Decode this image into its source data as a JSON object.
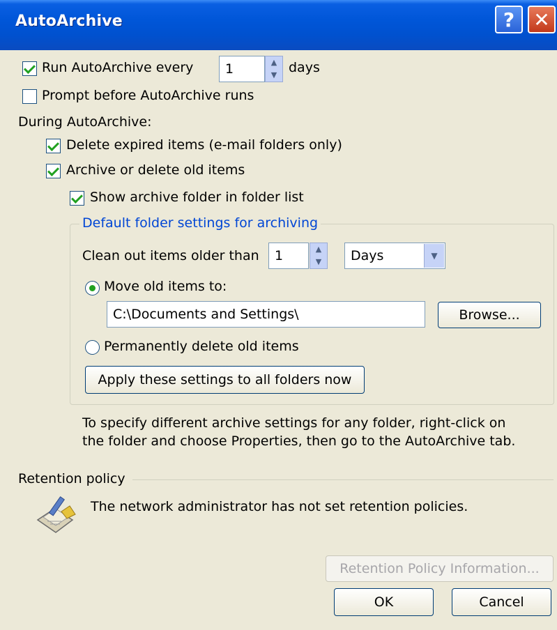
{
  "window": {
    "title": "AutoArchive",
    "help_label": "?",
    "close_label": "✕"
  },
  "run_every": {
    "label": "Run AutoArchive every",
    "value": "1",
    "unit": "days",
    "checked": true
  },
  "prompt_before": {
    "label": "Prompt before AutoArchive runs",
    "checked": false
  },
  "during_heading": "During AutoArchive:",
  "delete_expired": {
    "label": "Delete expired items (e-mail folders only)",
    "checked": true
  },
  "archive_old": {
    "label": "Archive or delete old items",
    "checked": true
  },
  "show_folder": {
    "label": "Show archive folder in folder list",
    "checked": true
  },
  "defaults_group": {
    "title": "Default folder settings for archiving",
    "clean_label": "Clean out items older than",
    "clean_value": "1",
    "clean_unit": "Days",
    "move_label": "Move old items to:",
    "move_selected": true,
    "path_value": "C:\\Documents and Settings\\",
    "browse_label": "Browse...",
    "perm_delete_label": "Permanently delete old items",
    "apply_label": "Apply these settings to all folders now"
  },
  "note_text": "To specify different archive settings for any folder, right-click on the folder and choose Properties, then go to the AutoArchive tab.",
  "retention": {
    "heading": "Retention policy",
    "message": "The network administrator has not set retention policies.",
    "info_label": "Retention Policy Information...",
    "icon": "retention-policy-icon"
  },
  "footer": {
    "ok_label": "OK",
    "cancel_label": "Cancel"
  },
  "colors": {
    "titlebar": "#0054e3",
    "dialog_bg": "#ece9d8",
    "group_title": "#0046d5",
    "check": "#21a121"
  }
}
